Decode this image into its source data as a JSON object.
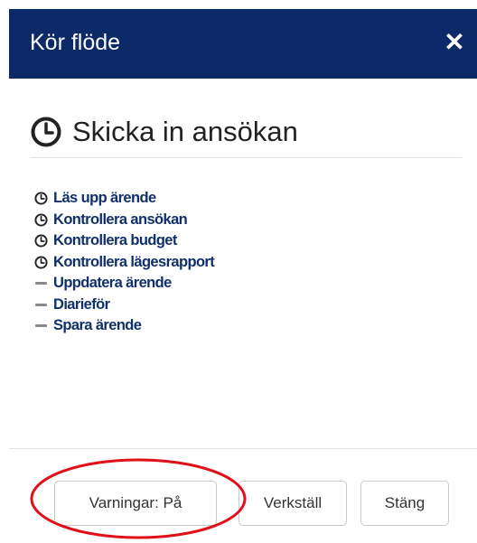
{
  "dialog": {
    "title": "Kör flöde",
    "close_glyph": "✕",
    "header_color": "#0c2a67"
  },
  "section": {
    "title": "Skicka in ansökan",
    "icon": "clock-icon"
  },
  "steps": [
    {
      "label": "Läs upp ärende",
      "icon": "clock-icon"
    },
    {
      "label": "Kontrollera ansökan",
      "icon": "clock-icon"
    },
    {
      "label": "Kontrollera budget",
      "icon": "clock-icon"
    },
    {
      "label": "Kontrollera lägesrapport",
      "icon": "clock-icon"
    },
    {
      "label": "Uppdatera ärende",
      "icon": "dash-icon"
    },
    {
      "label": "Diarieför",
      "icon": "dash-icon"
    },
    {
      "label": "Spara ärende",
      "icon": "dash-icon"
    }
  ],
  "footer": {
    "warnings_button": "Varningar: På",
    "apply_button": "Verkställ",
    "close_button": "Stäng"
  },
  "colors": {
    "link": "#10306b",
    "annotation": "#e0101a"
  }
}
